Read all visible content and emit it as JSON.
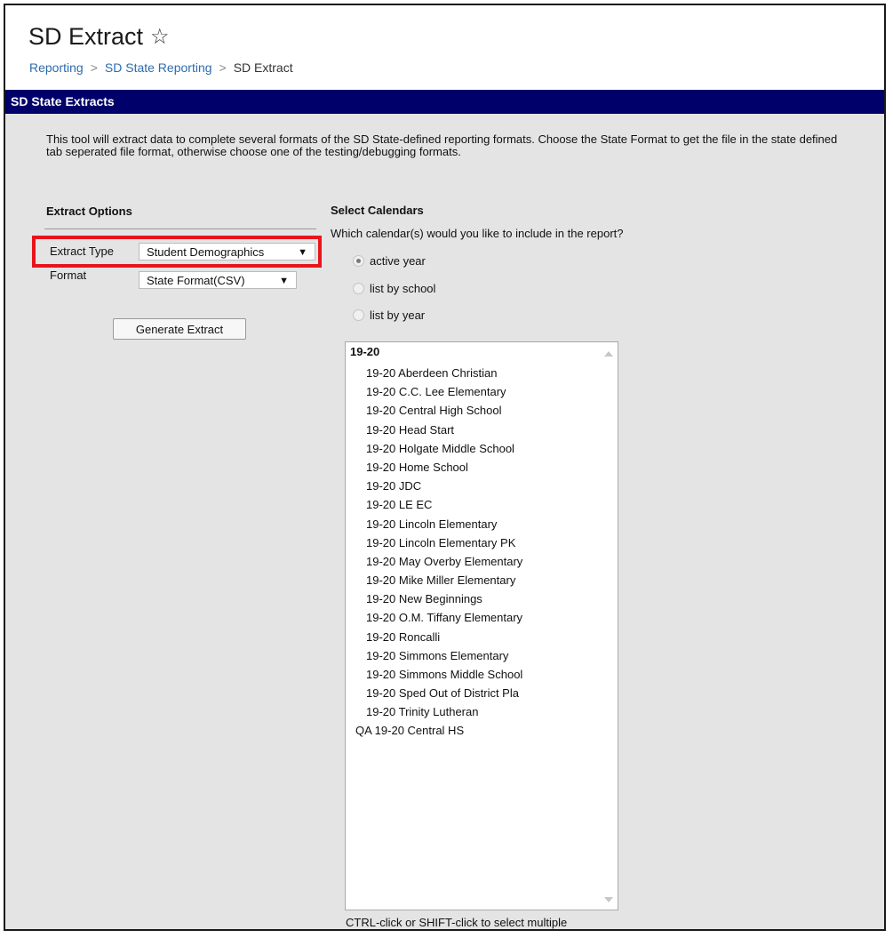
{
  "page": {
    "title": "SD Extract",
    "favorite_icon": "star-outline-icon",
    "breadcrumb": [
      "Reporting",
      "SD State Reporting",
      "SD Extract"
    ]
  },
  "panel": {
    "title": "SD State Extracts",
    "description": "This tool will extract data to complete several formats of the SD State-defined reporting formats. Choose the State Format to get the file in the state defined tab seperated file format, otherwise choose one of the testing/debugging formats."
  },
  "extract_options": {
    "heading": "Extract Options",
    "extract_type": {
      "label": "Extract Type",
      "value": "Student Demographics"
    },
    "format": {
      "label": "Format",
      "value": "State Format(CSV)"
    },
    "generate_button": "Generate Extract"
  },
  "calendars": {
    "heading": "Select Calendars",
    "question": "Which calendar(s) would you like to include in the report?",
    "radio_options": [
      {
        "label": "active year",
        "selected": true
      },
      {
        "label": "list by school",
        "selected": false
      },
      {
        "label": "list by year",
        "selected": false
      }
    ],
    "list_group": "19-20",
    "list_items": [
      "19-20 Aberdeen Christian",
      "19-20 C.C. Lee Elementary",
      "19-20 Central High School",
      "19-20 Head Start",
      "19-20 Holgate Middle School",
      "19-20 Home School",
      "19-20 JDC",
      "19-20 LE EC",
      "19-20 Lincoln Elementary",
      "19-20 Lincoln Elementary PK",
      "19-20 May Overby Elementary",
      "19-20 Mike Miller Elementary",
      "19-20 New Beginnings",
      "19-20 O.M. Tiffany Elementary",
      "19-20 Roncalli",
      "19-20 Simmons Elementary",
      "19-20 Simmons Middle School",
      "19-20 Sped Out of District Pla",
      "19-20 Trinity Lutheran"
    ],
    "extra_item": "QA 19-20 Central HS",
    "hint": "CTRL-click or SHIFT-click to select multiple"
  },
  "colors": {
    "panel_bar": "#00006b",
    "highlight": "#e8141c",
    "link": "#2b6cb0",
    "content_bg": "#e4e4e4"
  }
}
